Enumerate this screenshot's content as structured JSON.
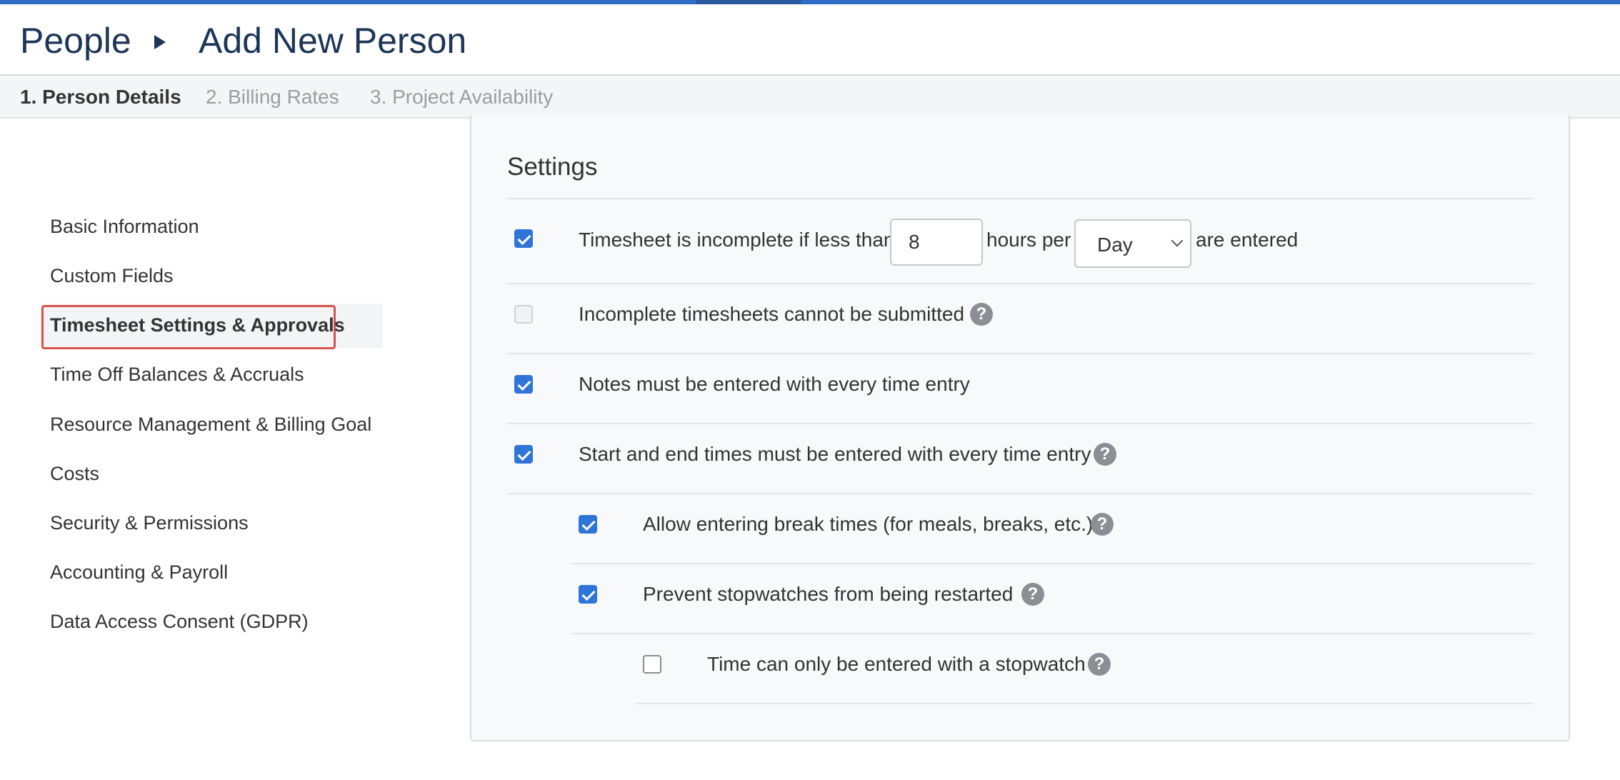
{
  "breadcrumb": {
    "root": "People",
    "current": "Add New Person"
  },
  "steps": [
    {
      "label": "1. Person Details",
      "active": true
    },
    {
      "label": "2. Billing Rates",
      "active": false
    },
    {
      "label": "3. Project Availability",
      "active": false
    }
  ],
  "sidebar": {
    "items": [
      {
        "label": "Basic Information",
        "active": false
      },
      {
        "label": "Custom Fields",
        "active": false
      },
      {
        "label": "Timesheet Settings & Approvals",
        "active": true
      },
      {
        "label": "Time Off Balances & Accruals",
        "active": false
      },
      {
        "label": "Resource Management & Billing Goal",
        "active": false
      },
      {
        "label": "Costs",
        "active": false
      },
      {
        "label": "Security & Permissions",
        "active": false
      },
      {
        "label": "Accounting & Payroll",
        "active": false
      },
      {
        "label": "Data Access Consent (GDPR)",
        "active": false
      }
    ]
  },
  "settings": {
    "title": "Settings",
    "incomplete_rule": {
      "checked": true,
      "prefix": "Timesheet is incomplete if less than",
      "hours_value": "8",
      "middle": "hours per",
      "period_value": "Day",
      "suffix": "are entered"
    },
    "options": [
      {
        "label": "Incomplete timesheets cannot be submitted",
        "checked": false,
        "disabled": true,
        "help": true
      },
      {
        "label": "Notes must be entered with every time entry",
        "checked": true,
        "help": false
      },
      {
        "label": "Start and end times must be entered with every time entry",
        "checked": true,
        "help": true
      },
      {
        "label": "Allow entering break times (for meals, breaks, etc.)",
        "checked": true,
        "help": true
      },
      {
        "label": "Prevent stopwatches from being restarted",
        "checked": true,
        "help": true
      },
      {
        "label": "Time can only be entered with a stopwatch",
        "checked": false,
        "help": true
      }
    ],
    "help_glyph": "?"
  },
  "colors": {
    "accent": "#2f75d8",
    "top_bar": "#2e6cc5",
    "title_text": "#1d3557",
    "highlight_frame": "#d9534f"
  },
  "icons": {
    "breadcrumb_separator": "triangle-right-icon",
    "checkbox": "checkbox-icon",
    "help": "question-circle-icon",
    "dropdown": "chevron-down-icon"
  }
}
